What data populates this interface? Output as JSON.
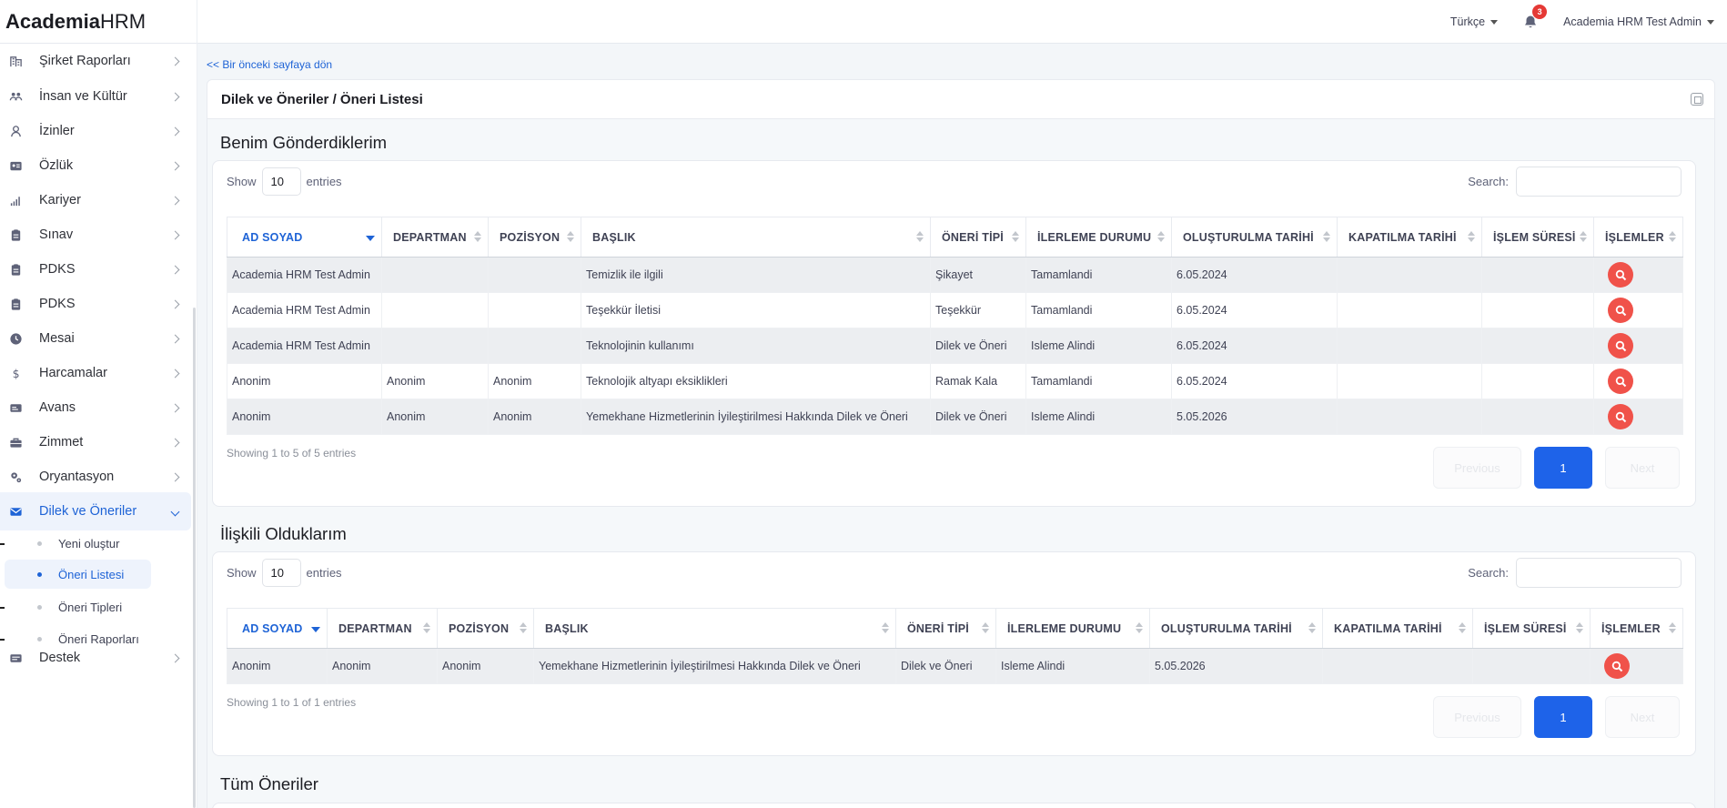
{
  "brand": {
    "bold": "Academia",
    "thin": "HRM"
  },
  "topbar": {
    "language": "Türkçe",
    "notification_count": "3",
    "user": "Academia HRM Test Admin"
  },
  "sidebar": {
    "items": [
      {
        "label": "Şirket Raporları",
        "icon": "building-icon"
      },
      {
        "label": "İnsan ve Kültür",
        "icon": "people-icon"
      },
      {
        "label": "İzinler",
        "icon": "person-icon"
      },
      {
        "label": "Özlük",
        "icon": "id-card-icon"
      },
      {
        "label": "Kariyer",
        "icon": "signal-icon"
      },
      {
        "label": "Sınav",
        "icon": "clipboard-icon"
      },
      {
        "label": "PDKS",
        "icon": "clipboard-icon"
      },
      {
        "label": "PDKS",
        "icon": "clipboard-icon"
      },
      {
        "label": "Mesai",
        "icon": "clock-icon"
      },
      {
        "label": "Harcamalar",
        "icon": "dollar-icon"
      },
      {
        "label": "Avans",
        "icon": "card-icon"
      },
      {
        "label": "Zimmet",
        "icon": "briefcase-icon"
      },
      {
        "label": "Oryantasyon",
        "icon": "gears-icon"
      },
      {
        "label": "Dilek ve Öneriler",
        "icon": "envelope-icon"
      },
      {
        "label": "Destek",
        "icon": "support-icon"
      }
    ],
    "subitems": [
      "Yeni oluştur",
      "Öneri Listesi",
      "Öneri Tipleri",
      "Öneri Raporları"
    ]
  },
  "back_link": "<< Bir önceki sayfaya dön",
  "page_title": "Dilek ve Öneriler / Öneri Listesi",
  "common": {
    "show": "Show",
    "entries": "entries",
    "search": "Search:",
    "page_size": "10",
    "previous": "Previous",
    "next": "Next",
    "current_page": "1"
  },
  "columns": [
    "AD SOYAD",
    "DEPARTMAN",
    "POZİSYON",
    "BAŞLIK",
    "ÖNERİ TİPİ",
    "İLERLEME DURUMU",
    "OLUŞTURULMA TARİHİ",
    "KAPATILMA TARİHİ",
    "İŞLEM SÜRESİ",
    "İŞLEMLER"
  ],
  "section1": {
    "title": "Benim Gönderdiklerim",
    "rows": [
      [
        "Academia HRM Test Admin",
        "",
        "",
        "Temizlik ile ilgili",
        "Şikayet",
        "Tamamlandi",
        "6.05.2024",
        "",
        ""
      ],
      [
        "Academia HRM Test Admin",
        "",
        "",
        "Teşekkür İletisi",
        "Teşekkür",
        "Tamamlandi",
        "6.05.2024",
        "",
        ""
      ],
      [
        "Academia HRM Test Admin",
        "",
        "",
        "Teknolojinin kullanımı",
        "Dilek ve Öneri",
        "Isleme Alindi",
        "6.05.2024",
        "",
        ""
      ],
      [
        "Anonim",
        "Anonim",
        "Anonim",
        "Teknolojik altyapı eksiklikleri",
        "Ramak Kala",
        "Tamamlandi",
        "6.05.2024",
        "",
        ""
      ],
      [
        "Anonim",
        "Anonim",
        "Anonim",
        "Yemekhane Hizmetlerinin İyileştirilmesi Hakkında Dilek ve Öneri",
        "Dilek ve Öneri",
        "Isleme Alindi",
        "5.05.2026",
        "",
        ""
      ]
    ],
    "info": "Showing 1 to 5 of 5 entries"
  },
  "section2": {
    "title": "İlişkili Olduklarım",
    "rows": [
      [
        "Anonim",
        "Anonim",
        "Anonim",
        "Yemekhane Hizmetlerinin İyileştirilmesi Hakkında Dilek ve Öneri",
        "Dilek ve Öneri",
        "Isleme Alindi",
        "5.05.2026",
        "",
        ""
      ]
    ],
    "info": "Showing 1 to 1 of 1 entries"
  },
  "section3": {
    "title": "Tüm Öneriler"
  }
}
